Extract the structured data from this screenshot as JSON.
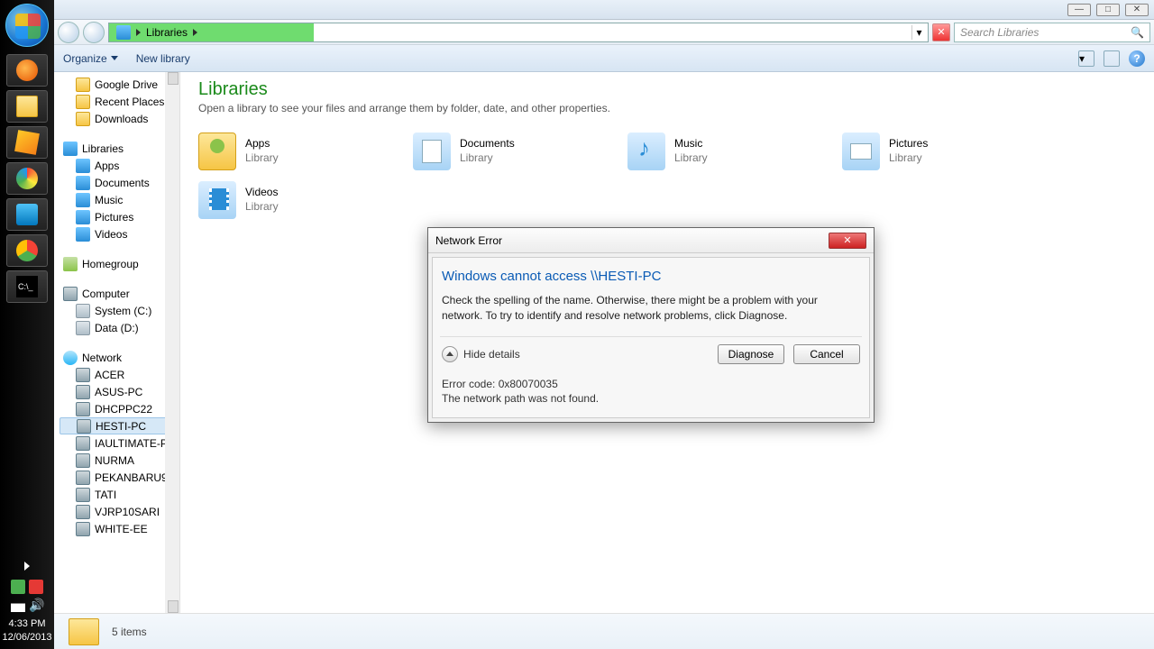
{
  "taskbar": {
    "clock_time": "4:33 PM",
    "clock_date": "12/06/2013"
  },
  "bgwin_buttons": [
    "—",
    "□",
    "✕"
  ],
  "explorer": {
    "breadcrumb": "Libraries",
    "search_placeholder": "Search Libraries",
    "organize": "Organize",
    "new_library": "New library",
    "title": "Libraries",
    "subtitle": "Open a library to see your files and arrange them by folder, date, and other properties.",
    "libs": [
      {
        "name": "Apps",
        "sub": "Library"
      },
      {
        "name": "Documents",
        "sub": "Library"
      },
      {
        "name": "Music",
        "sub": "Library"
      },
      {
        "name": "Pictures",
        "sub": "Library"
      },
      {
        "name": "Videos",
        "sub": "Library"
      }
    ],
    "status": "5 items",
    "tree_fav": [
      {
        "label": "Google Drive",
        "cls": "i-folder"
      },
      {
        "label": "Recent Places",
        "cls": "i-folder"
      },
      {
        "label": "Downloads",
        "cls": "i-folder"
      }
    ],
    "tree_lib_root": "Libraries",
    "tree_lib": [
      "Apps",
      "Documents",
      "Music",
      "Pictures",
      "Videos"
    ],
    "tree_home": "Homegroup",
    "tree_comp_root": "Computer",
    "tree_comp": [
      "System (C:)",
      "Data (D:)"
    ],
    "tree_net_root": "Network",
    "tree_net": [
      "ACER",
      "ASUS-PC",
      "DHCPPC22",
      "HESTI-PC",
      "IAULTIMATE-PC",
      "NURMA",
      "PEKANBARU9",
      "TATI",
      "VJRP10SARI",
      "WHITE-EE"
    ]
  },
  "dialog": {
    "title": "Network Error",
    "heading": "Windows cannot access \\\\HESTI-PC",
    "message": "Check the spelling of the name. Otherwise, there might be a problem with your network. To try to identify and resolve network problems, click Diagnose.",
    "hide": "Hide details",
    "diagnose": "Diagnose",
    "cancel": "Cancel",
    "err1": "Error code: 0x80070035",
    "err2": "The network path was not found."
  }
}
